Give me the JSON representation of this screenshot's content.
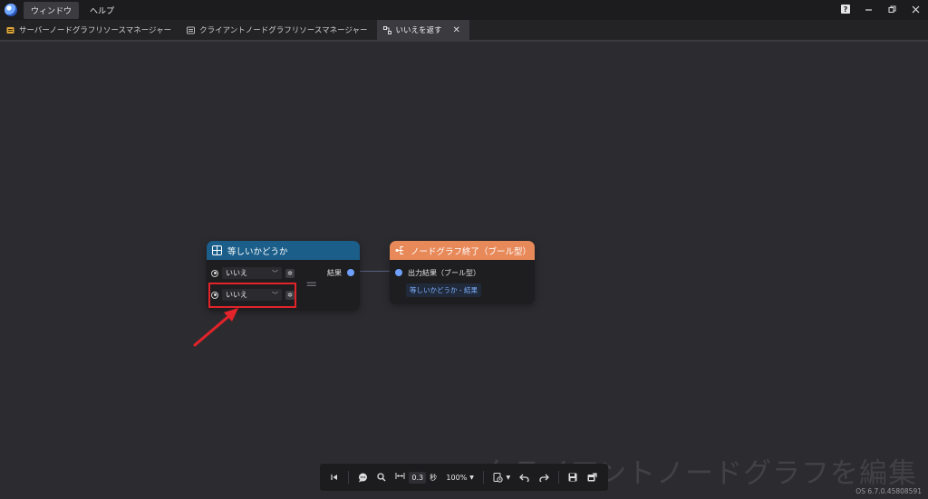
{
  "menubar": {
    "items": [
      "ウィンドウ",
      "ヘルプ"
    ],
    "help_glyph": "?"
  },
  "tabs": [
    {
      "label": "サーバーノードグラフリソースマネージャー",
      "icon": "folder-icon"
    },
    {
      "label": "クライアントノードグラフリソースマネージャー",
      "icon": "client-graph-icon"
    },
    {
      "label": "いいえを返す",
      "icon": "node-graph-icon",
      "active": true
    }
  ],
  "nodes": {
    "equals": {
      "title": "等しいかどうか",
      "header_color": "#1b5e8a",
      "inputs": [
        {
          "value": "いいえ"
        },
        {
          "value": "いいえ"
        }
      ],
      "operator": "=",
      "output_label": "結果"
    },
    "end": {
      "title": "ノードグラフ終了（ブール型）",
      "header_color": "#e8895a",
      "input_label": "出力結果（ブール型）",
      "link_label": "等しいかどうか - 結果"
    }
  },
  "toolbar": {
    "time_step": "0.3",
    "time_unit": "秒",
    "zoom": "100%"
  },
  "watermark": "クライアントノードグラフを編集",
  "version": "OS 6.7.0.45808591",
  "colors": {
    "accent_port": "#6fa0ff",
    "highlight": "#e2232a"
  }
}
